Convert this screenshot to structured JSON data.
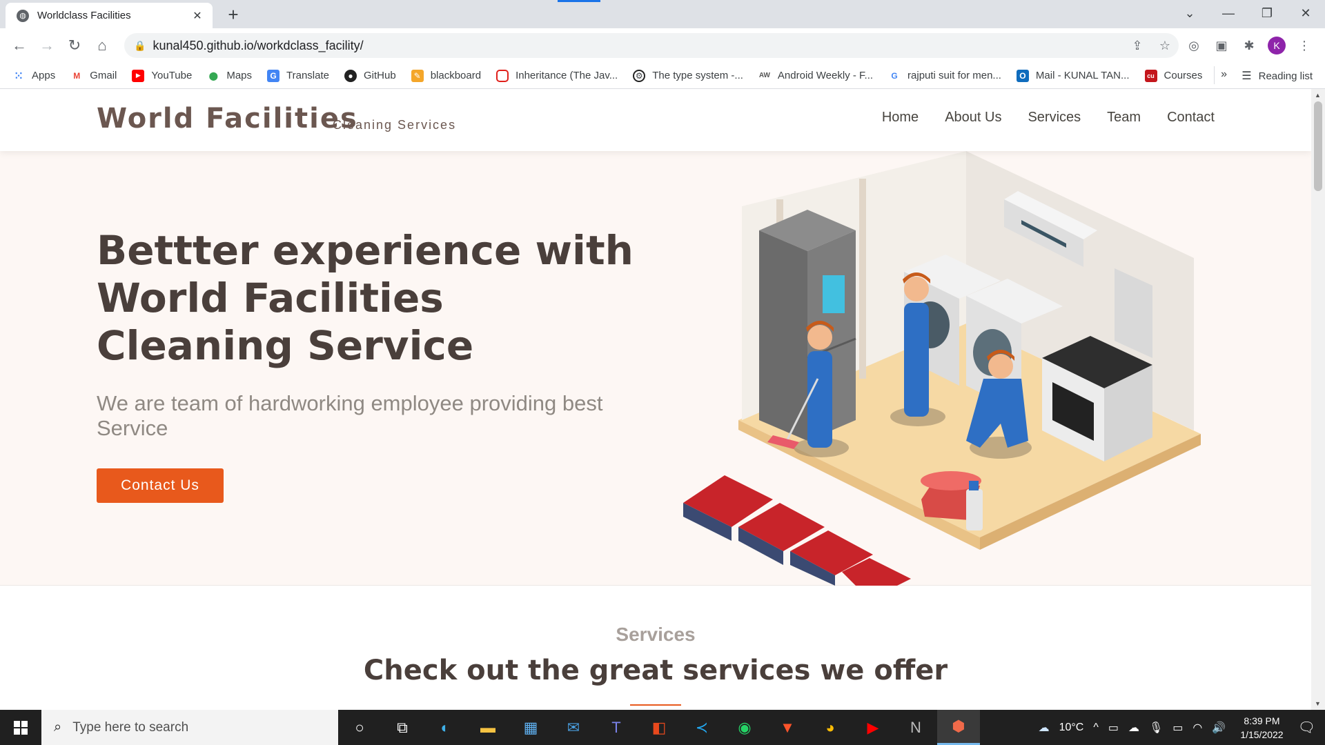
{
  "browser": {
    "tab_title": "Worldclass Facilities",
    "url": "kunal450.github.io/workdclass_facility/",
    "avatar_letter": "K",
    "bookmarks": [
      {
        "label": "Apps",
        "icon": "apps-grid-icon"
      },
      {
        "label": "Gmail",
        "icon": "gmail-icon"
      },
      {
        "label": "YouTube",
        "icon": "youtube-icon"
      },
      {
        "label": "Maps",
        "icon": "maps-pin-icon"
      },
      {
        "label": "Translate",
        "icon": "translate-icon"
      },
      {
        "label": "GitHub",
        "icon": "github-icon"
      },
      {
        "label": "blackboard",
        "icon": "blackboard-icon"
      },
      {
        "label": "Inheritance (The Jav...",
        "icon": "oracle-icon"
      },
      {
        "label": "The type system -...",
        "icon": "rust-icon"
      },
      {
        "label": "Android Weekly - F...",
        "icon": "android-weekly-icon"
      },
      {
        "label": "rajputi suit for men...",
        "icon": "google-icon"
      },
      {
        "label": "Mail - KUNAL TAN...",
        "icon": "outlook-icon"
      },
      {
        "label": "Courses",
        "icon": "courses-icon"
      }
    ],
    "more_bookmarks": "»",
    "reading_list": "Reading list"
  },
  "site": {
    "logo": "World Facilities",
    "logo_sub": "Cleaning Services",
    "nav": [
      "Home",
      "About Us",
      "Services",
      "Team",
      "Contact"
    ],
    "hero_title": "Bettter experience with World Facilities Cleaning Service",
    "hero_subtitle": "We are team of hardworking employee providing best Service",
    "cta": "Contact Us",
    "services_label": "Services",
    "services_heading": "Check out the great services we offer"
  },
  "taskbar": {
    "search_placeholder": "Type here to search",
    "temperature": "10°C",
    "time": "8:39 PM",
    "date": "1/15/2022"
  },
  "colors": {
    "accent": "#e8591c",
    "hero_bg": "#fdf7f4",
    "logo": "#6b5750"
  }
}
